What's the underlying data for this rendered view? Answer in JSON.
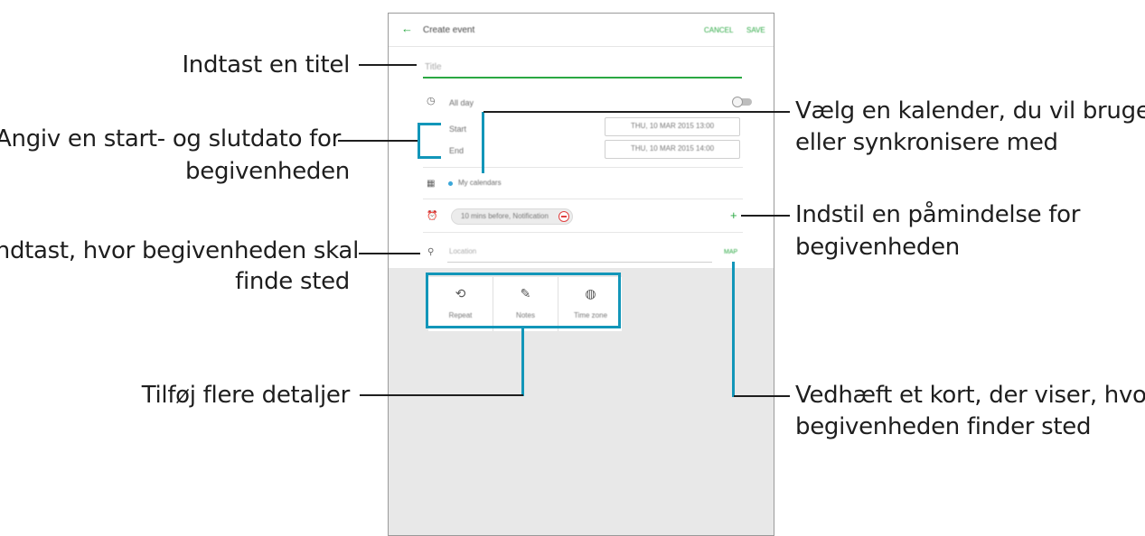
{
  "app": {
    "header_title": "Create event",
    "cancel_label": "CANCEL",
    "save_label": "SAVE",
    "title_placeholder": "Title",
    "allday_label": "All day",
    "start_label": "Start",
    "start_value": "THU, 10 MAR 2015   13:00",
    "end_label": "End",
    "end_value": "THU, 10 MAR 2015   14:00",
    "calendar_label": "My calendars",
    "reminder_label": "10 mins before, Notification",
    "location_placeholder": "Location",
    "map_label": "MAP",
    "buttons": [
      {
        "label": "Repeat",
        "icon": "repeat-icon"
      },
      {
        "label": "Notes",
        "icon": "notes-icon"
      },
      {
        "label": "Time zone",
        "icon": "time-zone-icon"
      }
    ]
  },
  "callouts": {
    "title": "Indtast en titel",
    "dates_line1": "Angiv en start- og slutdato for",
    "dates_line2": "begivenheden",
    "location_line1": "Indtast, hvor begivenheden skal",
    "location_line2": "finde sted",
    "details": "Tilføj flere detaljer",
    "calendar_line1": "Vælg en kalender, du vil bruge",
    "calendar_line2": "eller synkronisere med",
    "reminder_line1": "Indstil en påmindelse for",
    "reminder_line2": "begivenheden",
    "map_line1": "Vedhæft et kort, der viser, hvor",
    "map_line2": "begivenheden finder sted"
  },
  "colors": {
    "accent_green": "#2aa842",
    "callout_teal": "#1296b9",
    "calendar_dot": "#3ba7d9",
    "remove_red": "#e04040"
  }
}
